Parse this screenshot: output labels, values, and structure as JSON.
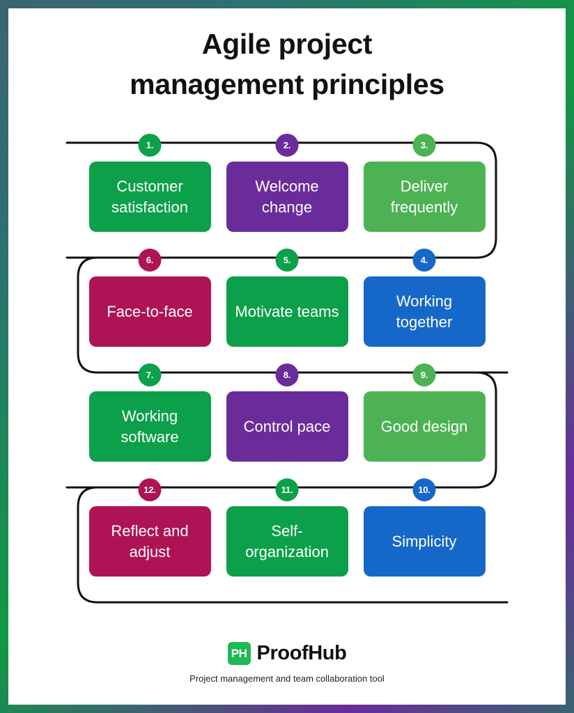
{
  "title": {
    "line1": "Agile project",
    "line2": "management principles"
  },
  "colors": {
    "green_dark": "#0CA04A",
    "green_light": "#4CB254",
    "purple": "#6A2C9B",
    "crimson": "#AE1355",
    "blue": "#1668C8",
    "line": "#111111",
    "text_on_box": "#FFFFFF"
  },
  "principles": [
    {
      "number": "1.",
      "label": "Customer satisfaction",
      "color": "#0CA04A",
      "badge_color": "#0CA04A"
    },
    {
      "number": "2.",
      "label": "Welcome change",
      "color": "#6A2C9B",
      "badge_color": "#6A2C9B"
    },
    {
      "number": "3.",
      "label": "Deliver frequently",
      "color": "#4CB254",
      "badge_color": "#4CB254"
    },
    {
      "number": "6.",
      "label": "Face-to-face",
      "color": "#AE1355",
      "badge_color": "#AE1355"
    },
    {
      "number": "5.",
      "label": "Motivate teams",
      "color": "#0CA04A",
      "badge_color": "#0CA04A"
    },
    {
      "number": "4.",
      "label": "Working together",
      "color": "#1668C8",
      "badge_color": "#1668C8"
    },
    {
      "number": "7.",
      "label": "Working software",
      "color": "#0CA04A",
      "badge_color": "#0CA04A"
    },
    {
      "number": "8.",
      "label": "Control pace",
      "color": "#6A2C9B",
      "badge_color": "#6A2C9B"
    },
    {
      "number": "9.",
      "label": "Good design",
      "color": "#4CB254",
      "badge_color": "#4CB254"
    },
    {
      "number": "12.",
      "label": "Reflect and adjust",
      "color": "#AE1355",
      "badge_color": "#AE1355"
    },
    {
      "number": "11.",
      "label": "Self-organization",
      "color": "#0CA04A",
      "badge_color": "#0CA04A"
    },
    {
      "number": "10.",
      "label": "Simplicity",
      "color": "#1668C8",
      "badge_color": "#1668C8"
    }
  ],
  "footer": {
    "logo_mark_text": "PH",
    "logo_mark_color": "#1DB954",
    "brand": "ProofHub",
    "tagline": "Project management and team collaboration tool"
  }
}
